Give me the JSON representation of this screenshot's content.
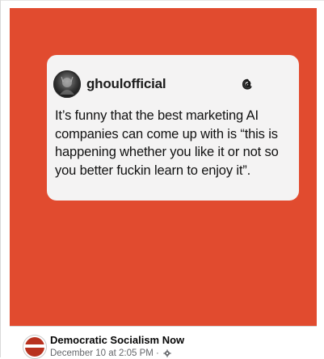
{
  "post": {
    "image": {
      "background_color": "#e14b2f",
      "card": {
        "avatar_icon": "profile-photo",
        "username": "ghoulofficial",
        "platform_icon": "threads-logo-icon",
        "text": "It’s funny that the best marketing AI companies can come up with is “this is happening whether you like it or not so you better fuckin learn to enjoy it”."
      }
    },
    "author": {
      "avatar_icon": "page-avatar",
      "name": "Democratic Socialism Now",
      "timestamp": "December 10 at 2:05 PM",
      "separator": "·",
      "audience_icon": "gear-icon"
    }
  }
}
